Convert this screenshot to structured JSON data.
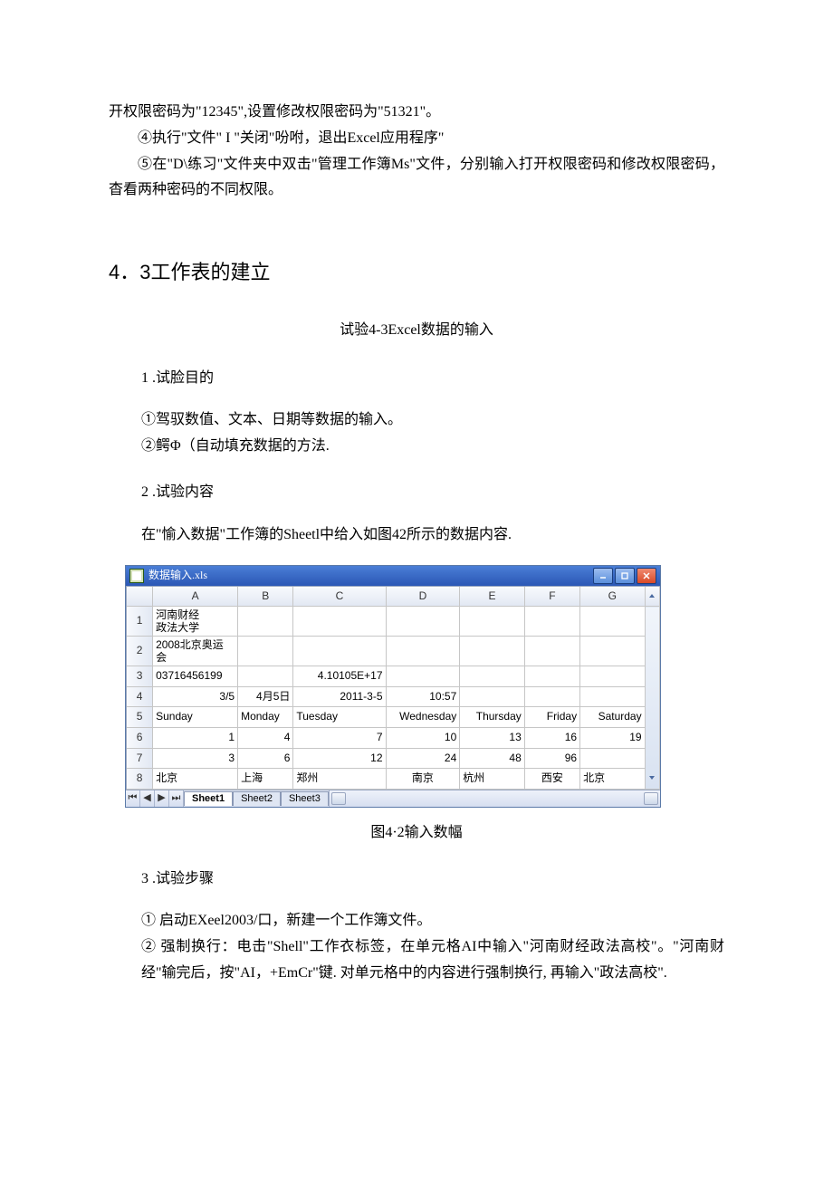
{
  "intro": {
    "p0": "开权限密码为\"12345\",设置修改权限密码为\"51321\"。",
    "p1": "④执行\"文件\" I \"关闭\"吩咐，退出Excel应用程序\"",
    "p2": "⑤在\"D\\练习\"文件夹中双击\"管理工作簿Ms\"文件，分别输入打开权限密码和修改权限密码，杳看两种密码的不同权限。"
  },
  "section": {
    "heading": "4．3工作表的建立",
    "subtitle": "试验4-3Excel数据的输入"
  },
  "purpose": {
    "heading": "1 .试脸目的",
    "p1": "①驾驭数值、文本、日期等数据的输入。",
    "p2": "②鳄Φ（自动填充数据的方法."
  },
  "content": {
    "heading": "2 .试验内容",
    "p1": "在\"愉入数据\"工作簿的Sheetl中给入如图42所示的数据内容."
  },
  "excel": {
    "title": "数据输入.xls",
    "columns": [
      "",
      "A",
      "B",
      "C",
      "D",
      "E",
      "F",
      "G",
      ""
    ],
    "rows": [
      {
        "n": "1",
        "cells": [
          "河南财经\n政法大学",
          "",
          "",
          "",
          "",
          "",
          ""
        ]
      },
      {
        "n": "2",
        "cells": [
          "2008北京奥运\n会",
          "",
          "",
          "",
          "",
          "",
          ""
        ]
      },
      {
        "n": "3",
        "cells": [
          "03716456199",
          "",
          "4.10105E+17",
          "",
          "",
          "",
          ""
        ]
      },
      {
        "n": "4",
        "cells": [
          "3/5",
          "4月5日",
          "2011-3-5",
          "10:57",
          "",
          "",
          ""
        ]
      },
      {
        "n": "5",
        "cells": [
          "Sunday",
          "Monday",
          "Tuesday",
          "Wednesday",
          "Thursday",
          "Friday",
          "Saturday"
        ]
      },
      {
        "n": "6",
        "cells": [
          "1",
          "4",
          "7",
          "10",
          "13",
          "16",
          "19"
        ]
      },
      {
        "n": "7",
        "cells": [
          "3",
          "6",
          "12",
          "24",
          "48",
          "96",
          ""
        ]
      },
      {
        "n": "8",
        "cells": [
          "北京",
          "上海",
          "郑州",
          "南京",
          "杭州",
          "西安",
          "北京"
        ]
      }
    ],
    "tabs": [
      "Sheet1",
      "Sheet2",
      "Sheet3"
    ]
  },
  "caption": "图4·2输入数幅",
  "steps": {
    "heading": "3 .试验步骤",
    "p1": "① 启动EXeel2003/口，新建一个工作簿文件。",
    "p2": "② 强制换行：电击\"Shell\"工作衣标签，在单元格AI中输入\"河南财经政法高校\"。\"河南财经\"输完后，按\"AI，+EmCr\"键. 对单元格中的内容进行强制换行, 再输入\"政法高校\"."
  }
}
